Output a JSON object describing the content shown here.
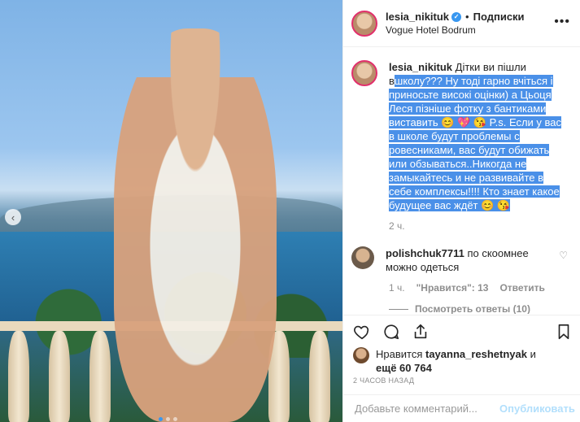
{
  "post": {
    "username": "lesia_nikituk",
    "follow_label": "Подписки",
    "location": "Vogue Hotel Bodrum",
    "caption_user": "lesia_nikituk",
    "caption_prefix": " Дітки ви пішли в",
    "caption_highlight": "школу??? Ну тоді гарно вчіться і приносьте високі оцінки) а Цьоця Леся пізніше фотку з бантиками виставить 😊 💖 😘 P.s. Если у вас в школе будут проблемы с ровесниками, вас будут обижать или обзываться..Никогда не замыкайтесь и не развивайте в себе комплексы!!!! Кто знает какое будущее вас ждёт 😊 😘",
    "caption_time": "2 ч."
  },
  "comment": {
    "user": "polishchuk7711",
    "text": " по скоомнее можно одеться",
    "time": "1 ч.",
    "likes": "\"Нравится\": 13",
    "reply": "Ответить",
    "view_replies": "Посмотреть ответы (10)"
  },
  "likes": {
    "prefix": "Нравится ",
    "user": "tayanna_reshetnyak",
    "mid": " и",
    "count_line": "ещё 60 764"
  },
  "posted_ago": "2 ЧАСОВ НАЗАД",
  "add_comment": {
    "placeholder": "Добавьте комментарий...",
    "publish": "Опубликовать"
  },
  "icons": [
    "heart-icon",
    "comment-icon",
    "share-icon",
    "bookmark-icon",
    "more-icon",
    "verified-icon",
    "prev-arrow-icon"
  ]
}
